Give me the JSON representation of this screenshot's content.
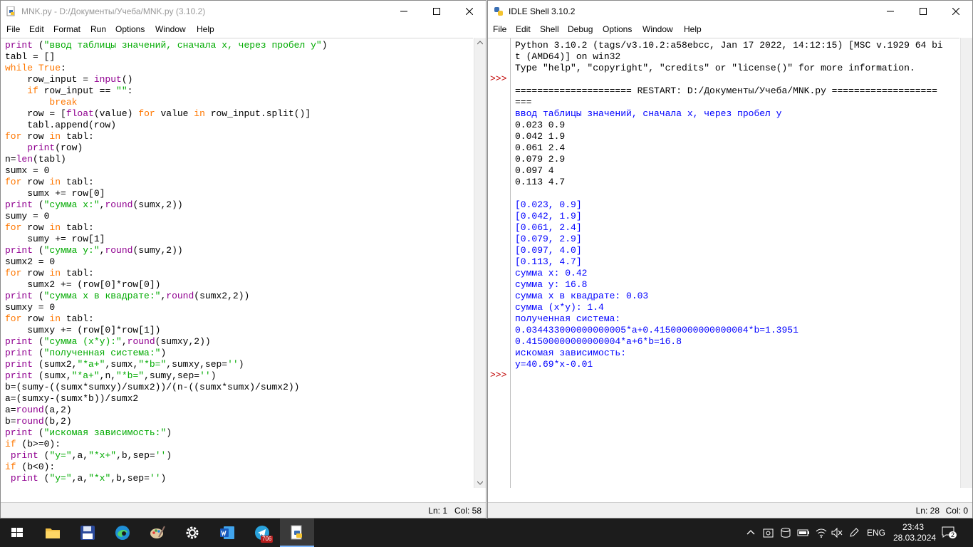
{
  "editor": {
    "title": "MNK.py - D:/Документы/Учеба/MNK.py (3.10.2)",
    "menu": [
      "File",
      "Edit",
      "Format",
      "Run",
      "Options",
      "Window",
      "Help"
    ],
    "status": {
      "line": "Ln: 1",
      "col": "Col: 58"
    },
    "code_lines": [
      "print (\"ввод таблицы значений, сначала x, через пробел y\")",
      "tabl = []",
      "while True:",
      "    row_input = input()",
      "    if row_input == \"\":",
      "        break",
      "    row = [float(value) for value in row_input.split()]",
      "    tabl.append(row)",
      "for row in tabl:",
      "    print(row)",
      "n=len(tabl)",
      "sumx = 0",
      "for row in tabl:",
      "    sumx += row[0]",
      "print (\"сумма x:\",round(sumx,2))",
      "sumy = 0",
      "for row in tabl:",
      "    sumy += row[1]",
      "print (\"сумма y:\",round(sumy,2))",
      "sumx2 = 0",
      "for row in tabl:",
      "    sumx2 += (row[0]*row[0])",
      "print (\"сумма x в квадрате:\",round(sumx2,2))",
      "sumxy = 0",
      "for row in tabl:",
      "    sumxy += (row[0]*row[1])",
      "print (\"сумма (x*y):\",round(sumxy,2))",
      "print (\"полученная система:\")",
      "print (sumx2,\"*a+\",sumx,\"*b=\",sumxy,sep='')",
      "print (sumx,\"*a+\",n,\"*b=\",sumy,sep='')",
      "b=(sumy-((sumx*sumxy)/sumx2))/(n-((sumx*sumx)/sumx2))",
      "a=(sumxy-(sumx*b))/sumx2",
      "a=round(a,2)",
      "b=round(b,2)",
      "print (\"искомая зависимость:\")",
      "if (b>=0):",
      " print (\"y=\",a,\"*x+\",b,sep='')",
      "if (b<0):",
      " print (\"y=\",a,\"*x\",b,sep='')"
    ]
  },
  "shell": {
    "title": "IDLE Shell 3.10.2",
    "menu": [
      "File",
      "Edit",
      "Shell",
      "Debug",
      "Options",
      "Window",
      "Help"
    ],
    "status": {
      "line": "Ln: 28",
      "col": "Col: 0"
    },
    "prompt": ">>>",
    "header_lines": [
      "Python 3.10.2 (tags/v3.10.2:a58ebcc, Jan 17 2022, 14:12:15) [MSC v.1929 64 bi",
      "t (AMD64)] on win32",
      "Type \"help\", \"copyright\", \"credits\" or \"license()\" for more information."
    ],
    "restart_lines": [
      "===================== RESTART: D:/Документы/Учеба/MNK.py ===================",
      "==="
    ],
    "output_lines": [
      {
        "t": "ввод таблицы значений, сначала x, через пробел y",
        "k": "out"
      },
      {
        "t": "0.023 0.9",
        "k": "in"
      },
      {
        "t": "0.042 1.9",
        "k": "in"
      },
      {
        "t": "0.061 2.4",
        "k": "in"
      },
      {
        "t": "0.079 2.9",
        "k": "in"
      },
      {
        "t": "0.097 4",
        "k": "in"
      },
      {
        "t": "0.113 4.7",
        "k": "in"
      },
      {
        "t": "",
        "k": "in"
      },
      {
        "t": "[0.023, 0.9]",
        "k": "out"
      },
      {
        "t": "[0.042, 1.9]",
        "k": "out"
      },
      {
        "t": "[0.061, 2.4]",
        "k": "out"
      },
      {
        "t": "[0.079, 2.9]",
        "k": "out"
      },
      {
        "t": "[0.097, 4.0]",
        "k": "out"
      },
      {
        "t": "[0.113, 4.7]",
        "k": "out"
      },
      {
        "t": "сумма x: 0.42",
        "k": "out"
      },
      {
        "t": "сумма y: 16.8",
        "k": "out"
      },
      {
        "t": "сумма x в квадрате: 0.03",
        "k": "out"
      },
      {
        "t": "сумма (x*y): 1.4",
        "k": "out"
      },
      {
        "t": "полученная система:",
        "k": "out"
      },
      {
        "t": "0.034433000000000005*a+0.41500000000000004*b=1.3951",
        "k": "out"
      },
      {
        "t": "0.41500000000000004*a+6*b=16.8",
        "k": "out"
      },
      {
        "t": "искомая зависимость:",
        "k": "out"
      },
      {
        "t": "y=40.69*x-0.01",
        "k": "out"
      }
    ]
  },
  "taskbar": {
    "telegram_badge": "706",
    "lang": "ENG",
    "time": "23:43",
    "date": "28.03.2024",
    "notification_count": "2"
  },
  "colors": {
    "keyword": "#ff7700",
    "builtin": "#900090",
    "string": "#00aa00",
    "output": "#0000ff",
    "prompt": "#c00000"
  }
}
